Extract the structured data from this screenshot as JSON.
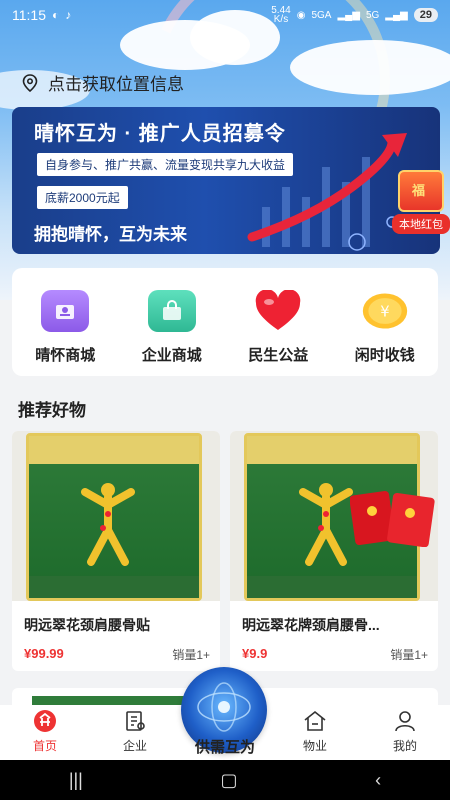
{
  "status": {
    "time": "11:15",
    "speed": "5.44\nK/s",
    "network1": "5GA",
    "network2": "5G",
    "battery": "29"
  },
  "location": {
    "label": "点击获取位置信息"
  },
  "banner": {
    "title": "晴怀互为 · 推广人员招募令",
    "pill1": "自身参与、推广共赢、流量变现共享九大收益",
    "pill2": "底薪2000元起",
    "slogan": "拥抱晴怀，互为未来",
    "float_label": "本地红包",
    "float_badge": "福"
  },
  "categories": [
    {
      "label": "晴怀商城",
      "icon": "mall-icon",
      "color": "#9b6cf2"
    },
    {
      "label": "企业商城",
      "icon": "shopping-bag-icon",
      "color": "#3dc7a6"
    },
    {
      "label": "民生公益",
      "icon": "heart-icon",
      "color": "#ee2233"
    },
    {
      "label": "闲时收钱",
      "icon": "coin-icon",
      "color": "#ffb420"
    }
  ],
  "section": {
    "title": "推荐好物"
  },
  "products": [
    {
      "name": "明远翠花颈肩腰骨贴",
      "price": "¥99.99",
      "sales": "销量1+"
    },
    {
      "name": "明远翠花牌颈肩腰骨...",
      "price": "¥9.9",
      "sales": "销量1+"
    }
  ],
  "tabs": [
    {
      "label": "首页",
      "icon": "home-icon",
      "active": true
    },
    {
      "label": "企业",
      "icon": "enterprise-icon",
      "active": false
    },
    {
      "label": "供需互为",
      "icon": "globe-icon",
      "active": false
    },
    {
      "label": "物业",
      "icon": "property-icon",
      "active": false
    },
    {
      "label": "我的",
      "icon": "profile-icon",
      "active": false
    }
  ],
  "colors": {
    "accent": "#e33333",
    "banner": "#1f4fae"
  }
}
